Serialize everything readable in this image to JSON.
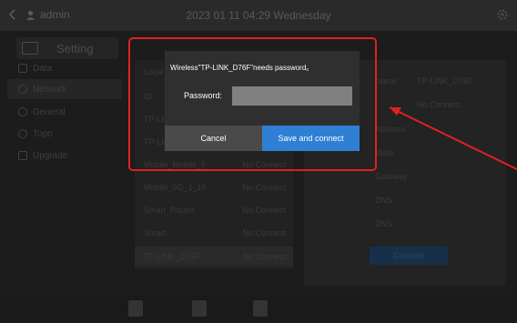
{
  "topbar": {
    "user": "admin",
    "datetime": "2023 01 11 04:29 Wednesday"
  },
  "sidebar": {
    "setting_label": "Setting",
    "items": [
      {
        "label": "Data"
      },
      {
        "label": "Network"
      },
      {
        "label": "General"
      },
      {
        "label": "Topo"
      },
      {
        "label": "Upgrade"
      }
    ]
  },
  "network_list": {
    "header": "Local",
    "rows": [
      {
        "name": "ID",
        "status": ""
      },
      {
        "name": "TP-LINK",
        "status": ""
      },
      {
        "name": "TP-LINK",
        "status": ""
      },
      {
        "name": "Mobile_Mobile_5",
        "status": "No Connect"
      },
      {
        "name": "Mobile_5G_1_10",
        "status": "No Connect"
      },
      {
        "name": "Smart_Router",
        "status": "No Connect"
      },
      {
        "name": "Smart",
        "status": "No Connect"
      },
      {
        "name": "TP-LINK_D76F",
        "status": "No Connect"
      }
    ]
  },
  "detail": {
    "name_label": "Name",
    "name_value": "TP-LINK_D76F",
    "status_value": "No Connect",
    "labels": [
      "Address",
      "Mask",
      "Gateway",
      "DNS",
      "DNS"
    ],
    "connect_label": "Connect"
  },
  "dialog": {
    "message": "Wireless\"TP-LINK_D76F\"needs password。",
    "password_label": "Password:",
    "password_value": "",
    "cancel_label": "Cancel",
    "save_label": "Save and connect"
  },
  "colors": {
    "primary_button": "#2f80d4",
    "annotation": "#e02020"
  }
}
